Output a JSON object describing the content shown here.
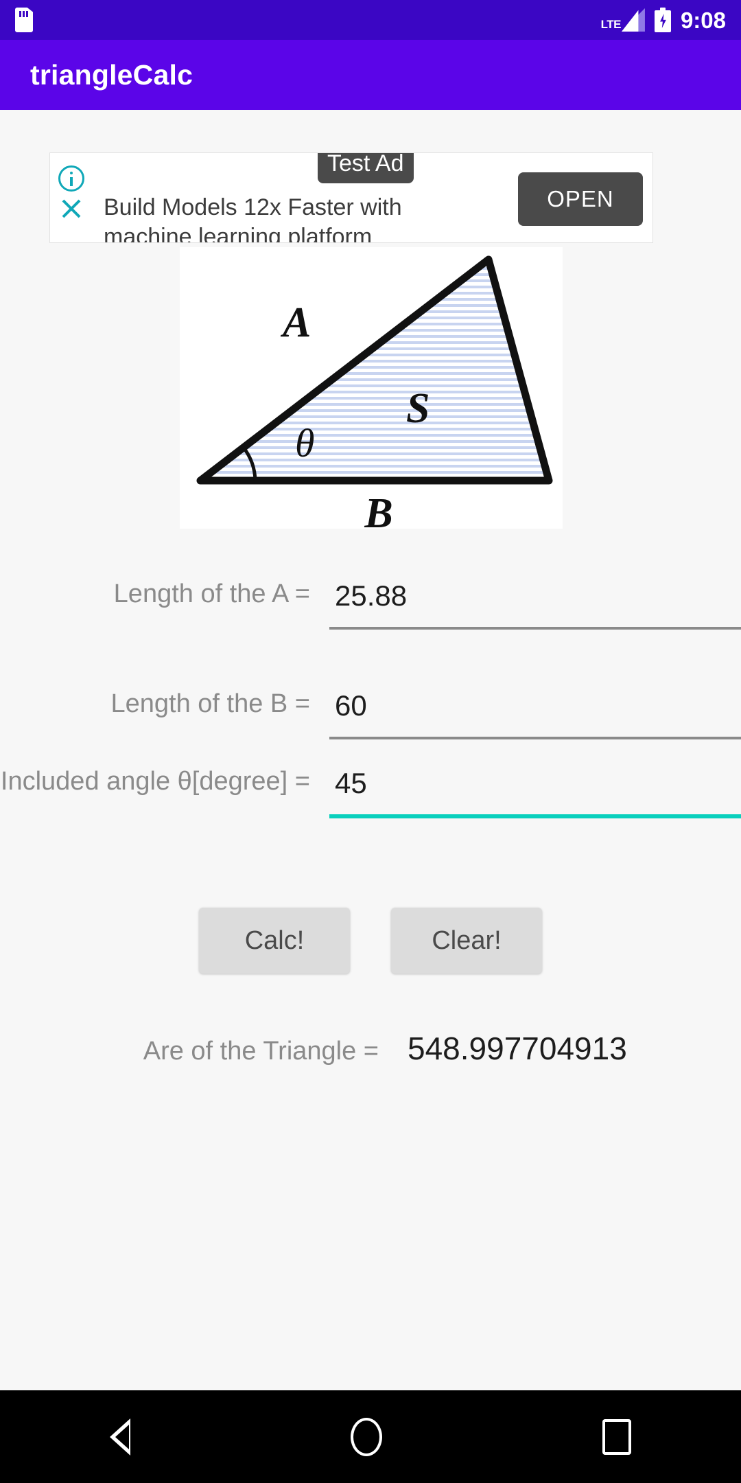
{
  "status_bar": {
    "sd_card_icon": "sd-card-icon",
    "network_label": "LTE",
    "signal_icon": "signal-bars-icon",
    "battery_icon": "battery-charging-icon",
    "time": "9:08",
    "background_color": "#3b06c4"
  },
  "app_bar": {
    "title": "triangleCalc",
    "background_color": "#5b05e8",
    "text_color": "#ffffff"
  },
  "ad": {
    "badge_label": "Test Ad",
    "headline_line1": "Build Models 12x Faster with",
    "headline_line2": "machine learning platform",
    "cta_label": "OPEN",
    "info_icon": "info-icon",
    "close_icon": "close-icon",
    "accent_color": "#10a8b8",
    "button_color": "#4a4a4a"
  },
  "figure": {
    "name": "triangle-diagram",
    "label_side_a": "A",
    "label_side_b": "B",
    "label_area": "S",
    "label_angle": "θ",
    "fill_color": "#c8d4f0",
    "stroke_color": "#111111"
  },
  "form": {
    "rows": [
      {
        "label": "Length of the A =",
        "value": "25.88",
        "focused": false,
        "name": "length-a"
      },
      {
        "label": "Length of the B =",
        "value": "60",
        "focused": false,
        "name": "length-b"
      },
      {
        "label": "Included angle θ[degree] =",
        "value": "45",
        "focused": true,
        "name": "included-angle"
      }
    ],
    "underline_color": "#8a8a8a",
    "focus_color": "#0ad0bd",
    "label_color": "#8a8a8a",
    "value_color": "#1d1d1d"
  },
  "buttons": {
    "calc_label": "Calc!",
    "clear_label": "Clear!",
    "background_color": "#dcdcdc",
    "text_color": "#4a4a4a"
  },
  "result": {
    "label": "Are of the Triangle =",
    "value": "548.997704913"
  },
  "nav_bar": {
    "back_icon": "back-triangle-icon",
    "home_icon": "home-circle-icon",
    "recents_icon": "recents-square-icon",
    "background_color": "#000000"
  }
}
